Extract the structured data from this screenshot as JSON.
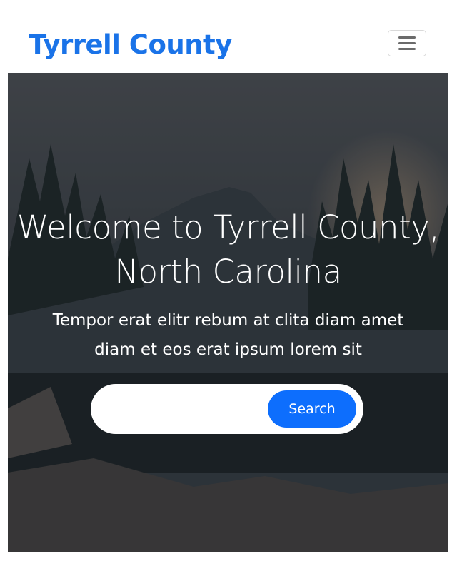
{
  "navbar": {
    "brand": "Tyrrell County",
    "menu_icon": "hamburger-menu-icon"
  },
  "hero": {
    "title": "Welcome to Tyrrell County, North Carolina",
    "subtitle": "Tempor erat elitr rebum at clita diam amet diam et eos erat ipsum lorem sit",
    "search": {
      "value": "",
      "placeholder": "",
      "button_label": "Search"
    }
  },
  "colors": {
    "brand": "#1a73e8",
    "button": "#0d6efd"
  }
}
